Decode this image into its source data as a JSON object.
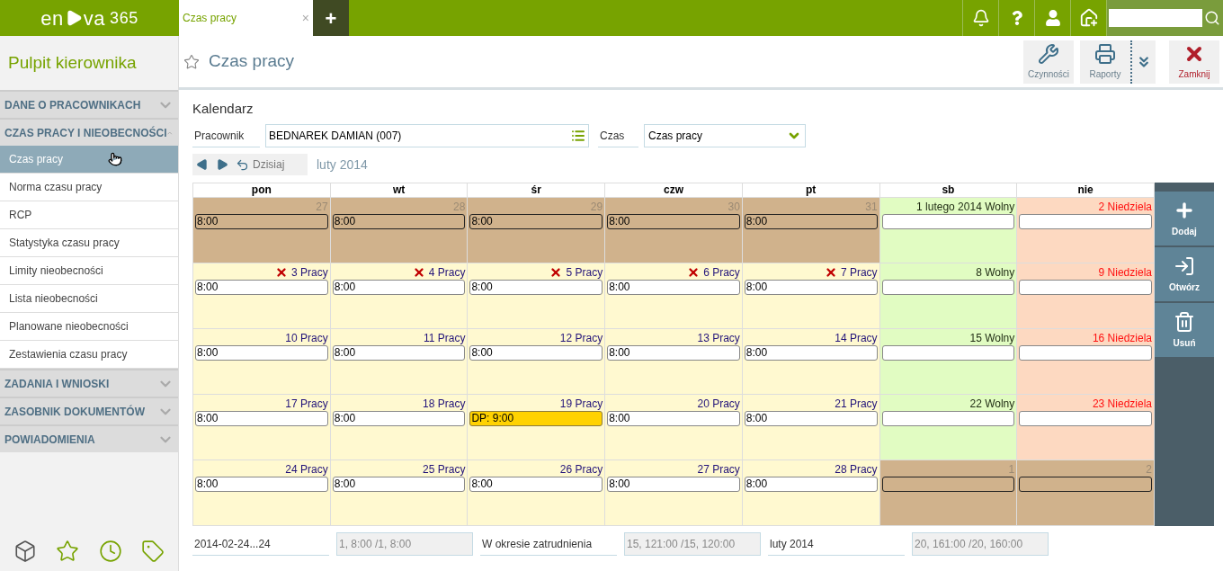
{
  "topbar": {
    "logo": {
      "before": "en",
      "after": "va",
      "suffix": "365"
    },
    "tab": {
      "label": "Czas pracy",
      "close": "×",
      "selected": true
    },
    "new_tab": "+"
  },
  "sidebar": {
    "title": "Pulpit kierownika",
    "sections": [
      {
        "label": "DANE O PRACOWNIKACH",
        "expanded": false
      },
      {
        "label": "CZAS PRACY I NIEOBECNOŚCI",
        "expanded": true,
        "items": [
          {
            "label": "Czas pracy",
            "selected": true
          },
          {
            "label": "Norma czasu pracy",
            "selected": false
          },
          {
            "label": "RCP",
            "selected": false
          },
          {
            "label": "Statystyka czasu pracy",
            "selected": false
          },
          {
            "label": "Limity nieobecności",
            "selected": false
          },
          {
            "label": "Lista nieobecności",
            "selected": false
          },
          {
            "label": "Planowane nieobecności",
            "selected": false
          },
          {
            "label": "Zestawienia czasu pracy",
            "selected": false
          }
        ]
      },
      {
        "label": "ZADANIA I WNIOSKI",
        "expanded": false
      },
      {
        "label": "ZASOBNIK DOKUMENTÓW",
        "expanded": false
      },
      {
        "label": "POWIADOMIENIA",
        "expanded": false
      }
    ]
  },
  "page": {
    "title": "Czas pracy",
    "favorite": false
  },
  "toolbar": [
    {
      "kind": "tools",
      "label": "Czynności"
    },
    {
      "kind": "print",
      "label": "Raporty"
    },
    {
      "kind": "more"
    },
    {
      "kind": "close",
      "label": "Zamknij"
    }
  ],
  "section_title": "Kalendarz",
  "form": {
    "employee_label": "Pracownik",
    "employee": "BEDNAREK DAMIAN (007)",
    "time_label": "Czas",
    "time": "Czas pracy"
  },
  "nav": {
    "today": "Dzisiaj",
    "month": "luty 2014"
  },
  "calendar": {
    "weekdays": [
      "pon",
      "wt",
      "śr",
      "czw",
      "pt",
      "sb",
      "nie"
    ],
    "weeks": [
      [
        {
          "kind": "other",
          "label": "27",
          "absent": false,
          "entry": {
            "text": "8:00",
            "kind": "plain"
          }
        },
        {
          "kind": "other",
          "label": "28",
          "absent": false,
          "entry": {
            "text": "8:00",
            "kind": "plain"
          }
        },
        {
          "kind": "other",
          "label": "29",
          "absent": false,
          "entry": {
            "text": "8:00",
            "kind": "plain"
          }
        },
        {
          "kind": "other",
          "label": "30",
          "absent": false,
          "entry": {
            "text": "8:00",
            "kind": "plain"
          }
        },
        {
          "kind": "other",
          "label": "31",
          "absent": false,
          "entry": {
            "text": "8:00",
            "kind": "plain"
          }
        },
        {
          "kind": "free",
          "label": "1 lutego 2014 Wolny",
          "absent": false
        },
        {
          "kind": "sunday",
          "label": "2 Niedziela",
          "absent": false
        }
      ],
      [
        {
          "kind": "work",
          "label": "3 Pracy",
          "absent": true,
          "entry": {
            "text": "8:00",
            "kind": "plain"
          }
        },
        {
          "kind": "work",
          "label": "4 Pracy",
          "absent": true,
          "entry": {
            "text": "8:00",
            "kind": "plain"
          }
        },
        {
          "kind": "work",
          "label": "5 Pracy",
          "absent": true,
          "entry": {
            "text": "8:00",
            "kind": "plain"
          }
        },
        {
          "kind": "work",
          "label": "6 Pracy",
          "absent": true,
          "entry": {
            "text": "8:00",
            "kind": "plain"
          }
        },
        {
          "kind": "work",
          "label": "7 Pracy",
          "absent": true,
          "entry": {
            "text": "8:00",
            "kind": "plain"
          }
        },
        {
          "kind": "free",
          "label": "8 Wolny",
          "absent": false
        },
        {
          "kind": "sunday",
          "label": "9 Niedziela",
          "absent": false
        }
      ],
      [
        {
          "kind": "work",
          "label": "10 Pracy",
          "absent": false,
          "entry": {
            "text": "8:00",
            "kind": "plain"
          }
        },
        {
          "kind": "work",
          "label": "11 Pracy",
          "absent": false,
          "entry": {
            "text": "8:00",
            "kind": "plain"
          }
        },
        {
          "kind": "work",
          "label": "12 Pracy",
          "absent": false,
          "entry": {
            "text": "8:00",
            "kind": "plain"
          }
        },
        {
          "kind": "work",
          "label": "13 Pracy",
          "absent": false,
          "entry": {
            "text": "8:00",
            "kind": "plain"
          }
        },
        {
          "kind": "work",
          "label": "14 Pracy",
          "absent": false,
          "entry": {
            "text": "8:00",
            "kind": "plain"
          }
        },
        {
          "kind": "free",
          "label": "15 Wolny",
          "absent": false
        },
        {
          "kind": "sunday",
          "label": "16 Niedziela",
          "absent": false
        }
      ],
      [
        {
          "kind": "work",
          "label": "17 Pracy",
          "absent": false,
          "entry": {
            "text": "8:00",
            "kind": "plain"
          }
        },
        {
          "kind": "work",
          "label": "18 Pracy",
          "absent": false,
          "entry": {
            "text": "8:00",
            "kind": "plain"
          }
        },
        {
          "kind": "work",
          "label": "19 Pracy",
          "absent": false,
          "entry": {
            "text": "DP: 9:00",
            "kind": "leave"
          }
        },
        {
          "kind": "work",
          "label": "20 Pracy",
          "absent": false,
          "entry": {
            "text": "8:00",
            "kind": "plain"
          }
        },
        {
          "kind": "work",
          "label": "21 Pracy",
          "absent": false,
          "entry": {
            "text": "8:00",
            "kind": "plain"
          }
        },
        {
          "kind": "free",
          "label": "22 Wolny",
          "absent": false
        },
        {
          "kind": "sunday",
          "label": "23 Niedziela",
          "absent": false
        }
      ],
      [
        {
          "kind": "work",
          "label": "24 Pracy",
          "absent": false,
          "entry": {
            "text": "8:00",
            "kind": "plain"
          }
        },
        {
          "kind": "work",
          "label": "25 Pracy",
          "absent": false,
          "entry": {
            "text": "8:00",
            "kind": "plain"
          }
        },
        {
          "kind": "work",
          "label": "26 Pracy",
          "absent": false,
          "entry": {
            "text": "8:00",
            "kind": "plain"
          }
        },
        {
          "kind": "work",
          "label": "27 Pracy",
          "absent": false,
          "entry": {
            "text": "8:00",
            "kind": "plain"
          }
        },
        {
          "kind": "work",
          "label": "28 Pracy",
          "absent": false,
          "entry": {
            "text": "8:00",
            "kind": "plain"
          }
        },
        {
          "kind": "other",
          "label": "1",
          "absent": false
        },
        {
          "kind": "other",
          "label": "2",
          "absent": false
        }
      ]
    ]
  },
  "actions": [
    {
      "kind": "add",
      "label": "Dodaj"
    },
    {
      "kind": "open",
      "label": "Otwórz"
    },
    {
      "kind": "delete",
      "label": "Usuń"
    }
  ],
  "footer": [
    {
      "kind": "text",
      "value": "2014-02-24...24"
    },
    {
      "kind": "readonly",
      "value": "1, 8:00 /1, 8:00"
    },
    {
      "kind": "text",
      "value": "W okresie zatrudnienia"
    },
    {
      "kind": "readonly",
      "value": "15, 121:00 /15, 120:00"
    },
    {
      "kind": "text",
      "value": "luty 2014"
    },
    {
      "kind": "readonly",
      "value": "20, 161:00 /20, 160:00"
    }
  ]
}
